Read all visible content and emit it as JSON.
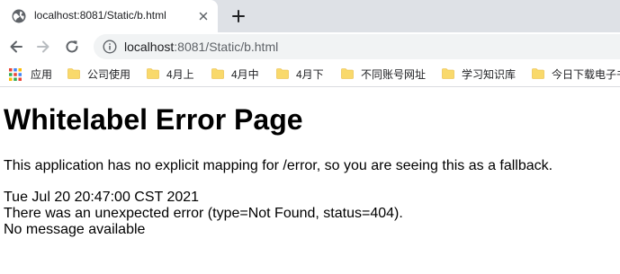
{
  "tab": {
    "title": "localhost:8081/Static/b.html"
  },
  "omnibox": {
    "host": "localhost",
    "rest": ":8081/Static/b.html"
  },
  "bookmarks": {
    "apps_label": "应用",
    "items": [
      {
        "label": "公司使用"
      },
      {
        "label": "4月上"
      },
      {
        "label": "4月中"
      },
      {
        "label": "4月下"
      },
      {
        "label": "不同账号网址"
      },
      {
        "label": "学习知识库"
      },
      {
        "label": "今日下载电子书"
      }
    ]
  },
  "page": {
    "heading": "Whitelabel Error Page",
    "explanation": "This application has no explicit mapping for /error, so you are seeing this as a fallback.",
    "timestamp": "Tue Jul 20 20:47:00 CST 2021",
    "error_line": "There was an unexpected error (type=Not Found, status=404).",
    "message": "No message available"
  },
  "colors": {
    "tabstrip_bg": "#dee1e6",
    "omnibox_bg": "#f1f3f4",
    "folder_yellow": "#f9d96b",
    "icon_gray": "#5f6368"
  }
}
